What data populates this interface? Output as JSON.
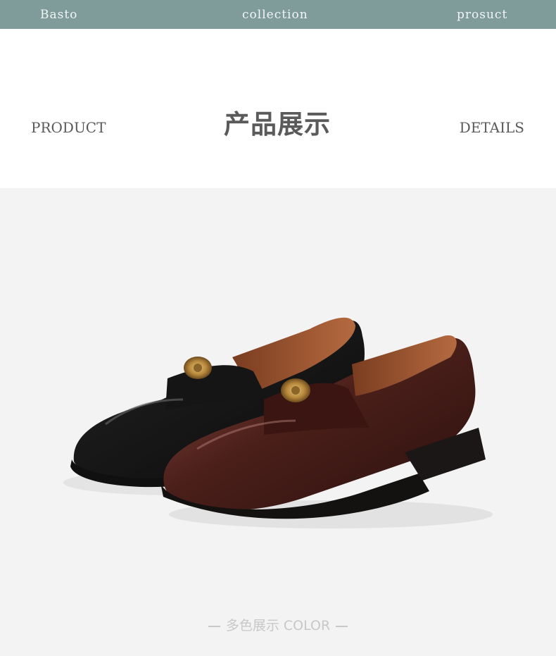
{
  "top_nav": {
    "items": [
      "Basto",
      "collection",
      "prosuct"
    ],
    "background": "#7f9b9a"
  },
  "header": {
    "left": "PRODUCT",
    "title": "产品展示",
    "right": "DETAILS"
  },
  "stage": {
    "caption": "多色展示 COLOR"
  },
  "colors": {
    "text": "#5a5a5a",
    "caption": "#c8c8c8",
    "stage_bg": "#f3f3f3"
  }
}
